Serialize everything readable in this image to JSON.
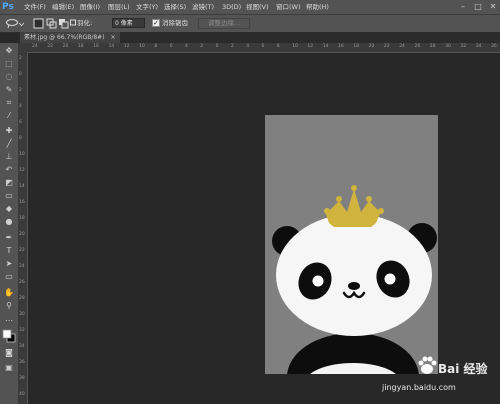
{
  "app": {
    "logo": "Ps"
  },
  "menu": [
    "文件(F)",
    "编辑(E)",
    "图像(I)",
    "图层(L)",
    "文字(Y)",
    "选择(S)",
    "滤镜(T)",
    "3D(D)",
    "视图(V)",
    "窗口(W)",
    "帮助(H)"
  ],
  "window_controls": {
    "minimize": "–",
    "maximize": "□",
    "close": "✕"
  },
  "options": {
    "feather_label": "羽化:",
    "feather_value": "0 像素",
    "antialias_checked": "✓",
    "antialias_label": "消除锯齿",
    "refine_edge": "调整边缘..."
  },
  "document": {
    "tab_title": "素材.jpg @ 66.7%(RGB/8#)",
    "tab_close": "×"
  },
  "ruler": {
    "top": [
      "24",
      "22",
      "20",
      "18",
      "16",
      "14",
      "12",
      "10",
      "8",
      "6",
      "4",
      "2",
      "0",
      "2",
      "4",
      "6",
      "8",
      "10",
      "12",
      "14",
      "16",
      "18",
      "20",
      "22",
      "24",
      "26",
      "28",
      "30",
      "32",
      "34",
      "36"
    ],
    "left": [
      "2",
      "0",
      "2",
      "4",
      "6",
      "8",
      "10",
      "12",
      "14",
      "16",
      "18",
      "20",
      "22",
      "24",
      "26",
      "28",
      "30",
      "32",
      "34",
      "36",
      "38",
      "40"
    ]
  },
  "watermark": {
    "brand": "Bai 经验",
    "url": "jingyan.baidu.com"
  },
  "colors": {
    "crown": "#d1b43d",
    "panda_black": "#0d0d0d",
    "canvas_bg": "#808080"
  }
}
